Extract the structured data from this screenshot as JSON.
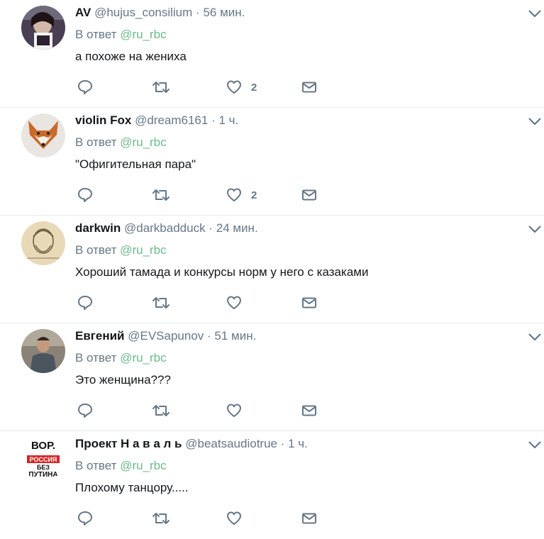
{
  "colors": {
    "mention": "#6cba8c",
    "secondary": "#657786",
    "icon": "#657786",
    "divider": "#e6ecf0"
  },
  "tweets": [
    {
      "name": "AV",
      "handle": "@hujus_consilium",
      "dot": "·",
      "time": "56 мин.",
      "reply_prefix": "В ответ",
      "reply_to": "@ru_rbc",
      "text": "а похоже на жениха",
      "likes": "2",
      "avatar_icon": "photo-avatar"
    },
    {
      "name": "violin Fox",
      "handle": "@dream6161",
      "dot": "·",
      "time": "1 ч.",
      "reply_prefix": "В ответ",
      "reply_to": "@ru_rbc",
      "text": "\"Офигительная пара\"",
      "likes": "2",
      "avatar_icon": "fox-avatar"
    },
    {
      "name": "darkwin",
      "handle": "@darkbadduck",
      "dot": "·",
      "time": "24 мин.",
      "reply_prefix": "В ответ",
      "reply_to": "@ru_rbc",
      "text": "Хороший тамада и конкурсы норм у него с казаками",
      "likes": "",
      "avatar_icon": "sketch-avatar"
    },
    {
      "name": "Евгений",
      "handle": "@EVSapunov",
      "dot": "·",
      "time": "51 мин.",
      "reply_prefix": "В ответ",
      "reply_to": "@ru_rbc",
      "text": "Это женщина???",
      "likes": "",
      "avatar_icon": "photo-avatar"
    },
    {
      "name": "Проект Н а в а л ь",
      "handle": "@beatsaudiotrue",
      "dot": "·",
      "time": "1 ч.",
      "reply_prefix": "В ответ",
      "reply_to": "@ru_rbc",
      "text": "Плохому танцору.....",
      "likes": "",
      "avatar_icon": "logo-avatar",
      "avatar_text": [
        "ВОР.",
        "РОССИЯ",
        "БЕЗ",
        "ПУТИНА"
      ]
    }
  ]
}
